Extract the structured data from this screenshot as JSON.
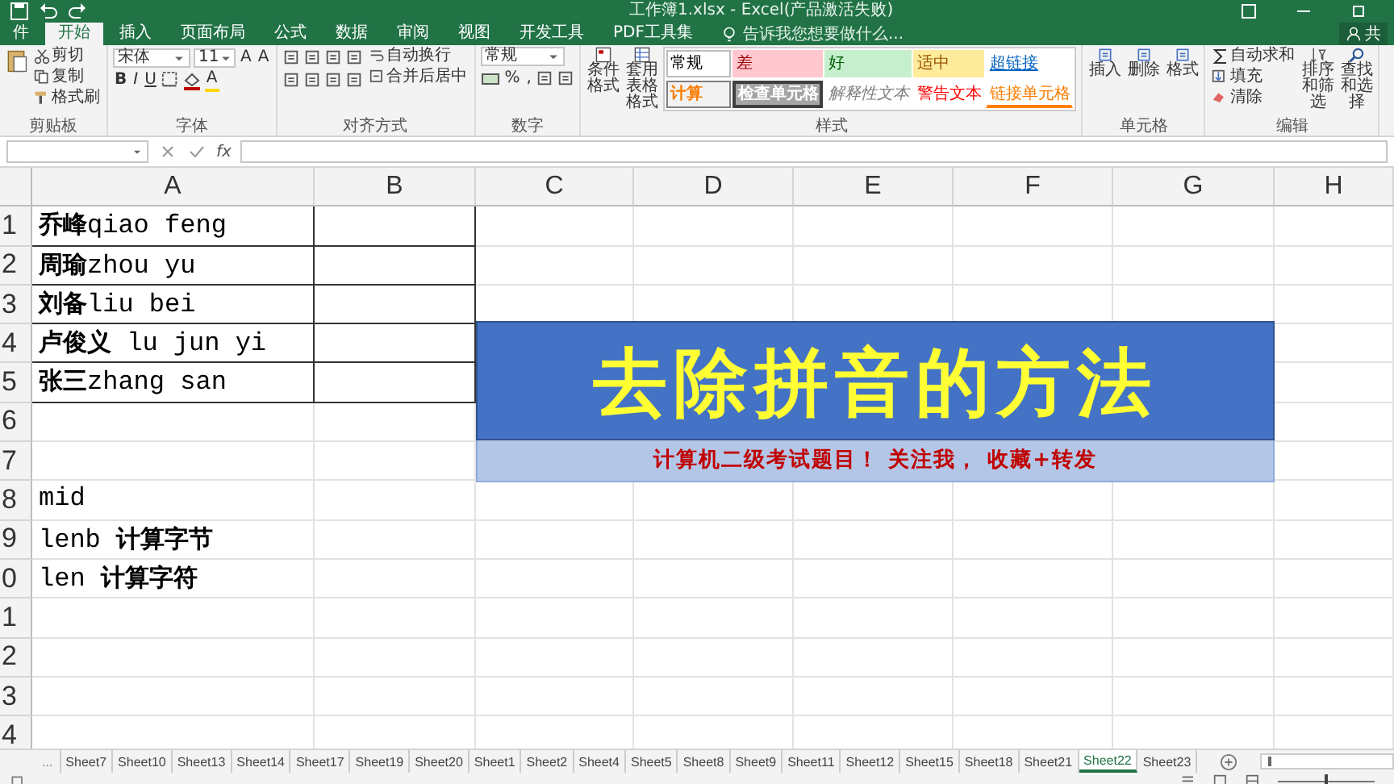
{
  "title_bar": {
    "title": "工作簿1.xlsx - Excel(产品激活失败)"
  },
  "menu_tabs": [
    {
      "label": "件",
      "selected": false
    },
    {
      "label": "开始",
      "selected": true
    },
    {
      "label": "插入",
      "selected": false
    },
    {
      "label": "页面布局",
      "selected": false
    },
    {
      "label": "公式",
      "selected": false
    },
    {
      "label": "数据",
      "selected": false
    },
    {
      "label": "审阅",
      "selected": false
    },
    {
      "label": "视图",
      "selected": false
    },
    {
      "label": "开发工具",
      "selected": false
    },
    {
      "label": "PDF工具集",
      "selected": false
    }
  ],
  "tell_me": {
    "placeholder": "告诉我您想要做什么..."
  },
  "share": {
    "label": "共"
  },
  "ribbon": {
    "clipboard": {
      "label": "剪贴板",
      "buttons": [
        "剪切",
        "复制",
        "格式刷"
      ]
    },
    "font": {
      "label": "字体",
      "font_name": "宋体",
      "font_size": "11",
      "size_buttons": [
        "A",
        "A"
      ],
      "format_buttons": [
        "B",
        "I",
        "U"
      ],
      "color_button": "A"
    },
    "alignment": {
      "label": "对齐方式",
      "buttons": [
        "自动换行",
        "合并后居中"
      ]
    },
    "number": {
      "label": "数字",
      "format": "常规",
      "buttons": [
        "%",
        ","
      ]
    },
    "styles": {
      "label": "样式",
      "buttons": [
        "条件格式",
        "套用表格格式"
      ],
      "cells": [
        {
          "label": "常规",
          "kind": "normal"
        },
        {
          "label": "差",
          "kind": "bad"
        },
        {
          "label": "好",
          "kind": "good"
        },
        {
          "label": "适中",
          "kind": "neutral"
        },
        {
          "label": "超链接",
          "kind": "hyperlink"
        },
        {
          "label": "计算",
          "kind": "calculation"
        },
        {
          "label": "检查单元格",
          "kind": "check"
        },
        {
          "label": "解释性文本",
          "kind": "explanatory"
        },
        {
          "label": "警告文本",
          "kind": "warning"
        },
        {
          "label": "链接单元格",
          "kind": "linked"
        }
      ]
    },
    "cells": {
      "label": "单元格",
      "buttons": [
        "插入",
        "删除",
        "格式"
      ]
    },
    "editing": {
      "label": "编辑",
      "buttons": [
        "自动求和",
        "填充",
        "清除"
      ],
      "large_buttons": [
        "排序和筛选",
        "查找和选择"
      ]
    }
  },
  "formula_bar": {
    "function_label": "fx"
  },
  "columns": [
    "A",
    "B",
    "C",
    "D",
    "E",
    "F",
    "G",
    "H"
  ],
  "rows": [
    {
      "header": "1",
      "a": "**乔峰**qiao feng",
      "bordered": true
    },
    {
      "header": "2",
      "a": "**周瑜**zhou yu",
      "bordered": true
    },
    {
      "header": "3",
      "a": "**刘备**liu bei",
      "bordered": true
    },
    {
      "header": "4",
      "a": "**卢俊义** lu jun yi",
      "bordered": true
    },
    {
      "header": "5",
      "a": "**张三**zhang san",
      "bordered": true
    },
    {
      "header": "6",
      "bordered": false
    },
    {
      "header": "7",
      "bordered": false
    },
    {
      "header": "8",
      "a": "mid",
      "bordered": false
    },
    {
      "header": "9",
      "a": "lenb **计算字节**",
      "bordered": false
    },
    {
      "header": "0",
      "a": "len **计算字符**",
      "bordered": false
    },
    {
      "header": "1",
      "bordered": false
    },
    {
      "header": "2",
      "bordered": false
    },
    {
      "header": "3",
      "bordered": false
    },
    {
      "header": "4",
      "bordered": false
    }
  ],
  "banner": {
    "title": "去除拼音的方法",
    "subtitle": "计算机二级考试题目！ 关注我， 收藏+转发"
  },
  "sheet_tabs": {
    "more": "...",
    "tabs": [
      {
        "label": "Sheet7",
        "selected": false
      },
      {
        "label": "Sheet10",
        "selected": false
      },
      {
        "label": "Sheet13",
        "selected": false
      },
      {
        "label": "Sheet14",
        "selected": false
      },
      {
        "label": "Sheet17",
        "selected": false
      },
      {
        "label": "Sheet19",
        "selected": false
      },
      {
        "label": "Sheet20",
        "selected": false
      },
      {
        "label": "Sheet1",
        "selected": false
      },
      {
        "label": "Sheet2",
        "selected": false
      },
      {
        "label": "Sheet4",
        "selected": false
      },
      {
        "label": "Sheet5",
        "selected": false
      },
      {
        "label": "Sheet8",
        "selected": false
      },
      {
        "label": "Sheet9",
        "selected": false
      },
      {
        "label": "Sheet11",
        "selected": false
      },
      {
        "label": "Sheet12",
        "selected": false
      },
      {
        "label": "Sheet15",
        "selected": false
      },
      {
        "label": "Sheet18",
        "selected": false
      },
      {
        "label": "Sheet21",
        "selected": false
      },
      {
        "label": "Sheet22",
        "selected": true
      },
      {
        "label": "Sheet23",
        "selected": false
      }
    ]
  },
  "status_bar": {
    "zoom_slider": {
      "level": 0.5
    }
  }
}
